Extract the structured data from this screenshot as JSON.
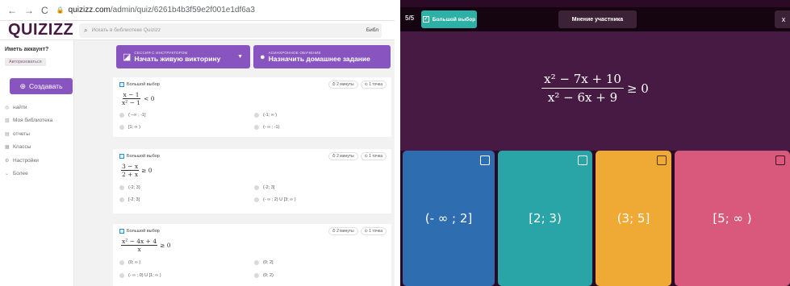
{
  "editor": {
    "url_host": "quizizz.com",
    "url_path": "/admin/quiz/6261b4b3f59e2f001e1df6a3",
    "logo": "QUIZIZZ",
    "search_placeholder": "Искать в библиотеке Quizizz",
    "library_short": "Библ",
    "account_prompt": "Иметь аккаунт?",
    "authorize_label": "Авторизоваться",
    "create_label": "Создавать",
    "nav": [
      "найти",
      "Моя библиотека",
      "отчеты",
      "Классы",
      "Настройки",
      "Более"
    ],
    "live_small": "СЕССИЯ С ИНСТРУКТОРОМ",
    "live_big": "Начать живую викторину",
    "hw_small": "АСИНХРОННОЕ ОБУЧЕНИЕ",
    "hw_big": "Назначить домашнее задание",
    "questions": [
      {
        "type": "Большой выбор",
        "time": "2 минуты",
        "points": "1 точка",
        "expr_num": "x − 1",
        "expr_den": "x² − 1",
        "expr_rel": "< 0",
        "options": [
          "( −∞ ; -1]",
          "(-1; ∞ )",
          "[1; ∞ )",
          "(- ∞ ; -1)"
        ]
      },
      {
        "type": "Большой выбор",
        "time": "2 минуты",
        "points": "1 точка",
        "expr_num": "3 − x",
        "expr_den": "2 + x",
        "expr_rel": "≥ 0",
        "options": [
          "(-2; 3)",
          "(-2; 3]",
          "[-2; 3]",
          "(- ∞ ; 2) U [3; ∞ )"
        ]
      },
      {
        "type": "Большой выбор",
        "time": "2 минуты",
        "points": "1 точка",
        "expr_num": "x² − 4x + 4",
        "expr_den": "x",
        "expr_rel": "≥ 0",
        "options": [
          "(0; ∞ )",
          "(0; 2]",
          "(- ∞ ; 0) U [1; ∞ )",
          "(0; 2)"
        ]
      }
    ]
  },
  "player": {
    "counter": "5/5",
    "type_label": "Большой выбор",
    "opinion_label": "Мнение участника",
    "close_label": "x",
    "expr_num": "x² − 7x + 10",
    "expr_den": "x² − 6x + 9",
    "expr_rel": "≥ 0",
    "answers": [
      "(- ∞ ; 2]",
      "[2; 3)",
      "(3; 5]",
      "[5; ∞ )"
    ],
    "answer_colors": [
      "#2f6db1",
      "#2aa5a7",
      "#efa935",
      "#d8597b"
    ]
  }
}
